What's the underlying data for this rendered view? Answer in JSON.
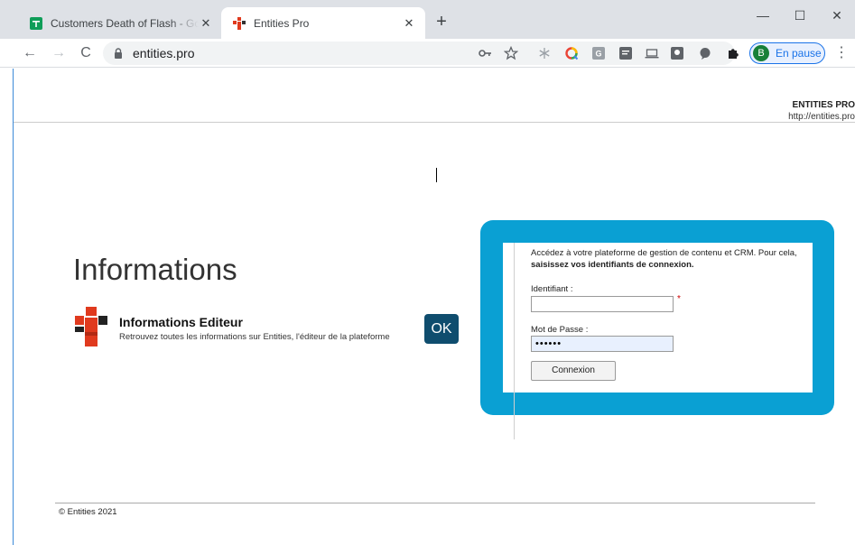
{
  "browser": {
    "tabs": [
      {
        "title": "Customers Death of Flash - Google Sheets",
        "active": false,
        "icon": "sheets-icon"
      },
      {
        "title": "Entities Pro",
        "active": true,
        "icon": "entities-favicon"
      }
    ],
    "new_tab_symbol": "+",
    "close_symbol": "✕",
    "window_controls": {
      "minimize": "—",
      "maximize": "☐",
      "close": "✕"
    },
    "nav": {
      "back": "←",
      "forward": "→",
      "reload": "C"
    },
    "address": "entities.pro",
    "profile": {
      "initial": "B",
      "status": "En pause"
    },
    "menu_symbol": "⋮",
    "extension_icons": [
      "key-icon",
      "star-icon",
      "snowflake-icon",
      "chrome-q-icon",
      "g-icon",
      "reader-icon",
      "laptop-icon",
      "portrait-icon",
      "chat-icon",
      "puzzle-icon"
    ]
  },
  "header": {
    "brand_name": "ENTITIES PRO",
    "brand_url": "http://entities.pro"
  },
  "main": {
    "heading": "Informations",
    "editor_title": "Informations Editeur",
    "editor_description": "Retrouvez toutes les informations sur Entities, l'éditeur de la plateforme",
    "ok_label": "OK"
  },
  "login": {
    "intro": "Accédez à votre plateforme de gestion de contenu et CRM. Pour cela,",
    "intro_bold": "saisissez vos identifiants de connexion.",
    "username_label": "Identifiant :",
    "username_value": "",
    "required_mark": "*",
    "password_label": "Mot de Passe :",
    "password_value": "••••••",
    "submit_label": "Connexion"
  },
  "footer": {
    "copyright": "© Entities 2021"
  },
  "colors": {
    "login_frame": "#0aa0d3",
    "ok_button": "#0f4d6e",
    "logo_red": "#e03a1e",
    "logo_dark": "#222222",
    "accent_blue": "#1a73e8"
  }
}
